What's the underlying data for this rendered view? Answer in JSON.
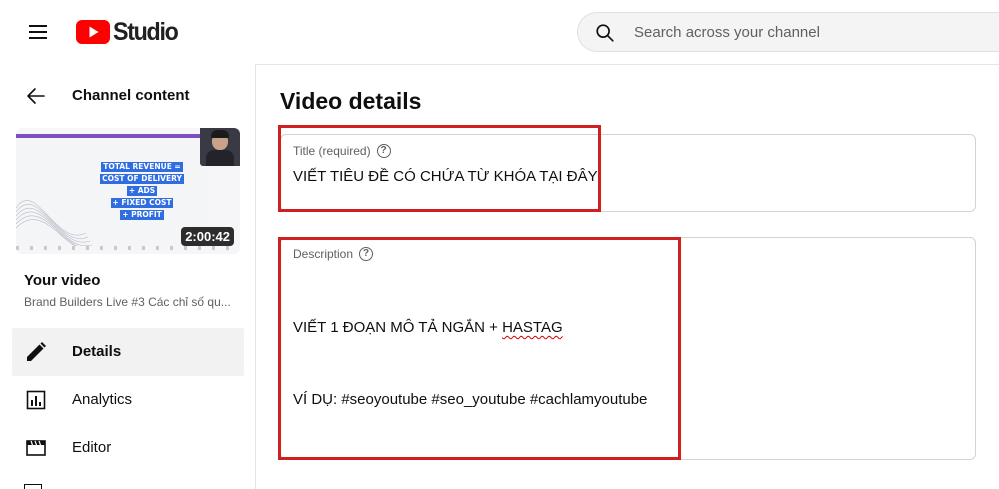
{
  "header": {
    "logo_text": "Studio",
    "search_placeholder": "Search across your channel"
  },
  "sidebar": {
    "back_label": "Channel content",
    "thumbnail": {
      "lines": [
        "TOTAL REVENUE =",
        "COST OF DELIVERY",
        "+ ADS",
        "+ FIXED COST",
        "+ PROFIT"
      ],
      "duration": "2:00:42"
    },
    "your_video_label": "Your video",
    "video_title": "Brand Builders Live #3 Các chỉ số qu...",
    "nav": [
      {
        "label": "Details",
        "icon": "pencil-icon",
        "active": true
      },
      {
        "label": "Analytics",
        "icon": "analytics-icon",
        "active": false
      },
      {
        "label": "Editor",
        "icon": "editor-icon",
        "active": false
      }
    ]
  },
  "main": {
    "page_title": "Video details",
    "title_field": {
      "label": "Title (required)",
      "value": "VIẾT TIÊU ĐỀ CÓ CHỨA TỪ KHÓA TẠI ĐÂY"
    },
    "description_field": {
      "label": "Description",
      "line1_prefix": "VIẾT 1 ĐOẠN MÔ TẢ NGẮN + ",
      "line1_misspelled": "HASTAG",
      "line2": "VÍ DỤ: #seoyoutube #seo_youtube #cachlamyoutube"
    }
  },
  "colors": {
    "brand_red": "#ff0000",
    "annotation_red": "#d01f1f",
    "active_nav_bg": "#f2f2f2"
  }
}
